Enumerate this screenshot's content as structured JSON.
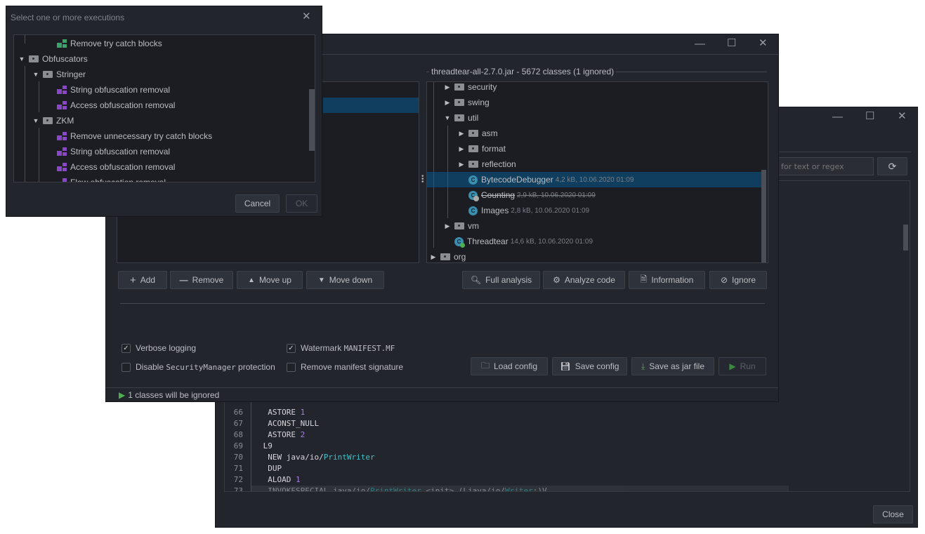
{
  "back_window": {
    "search_placeholder": "for text or regex",
    "close_label": "Close",
    "code_lines": [
      {
        "n": "66",
        "parts": [
          {
            "t": "  ASTORE "
          },
          {
            "t": "1",
            "c": "num"
          }
        ]
      },
      {
        "n": "67",
        "parts": [
          {
            "t": "  ACONST_NULL"
          }
        ]
      },
      {
        "n": "68",
        "parts": [
          {
            "t": "  ASTORE "
          },
          {
            "t": "2",
            "c": "num"
          }
        ]
      },
      {
        "n": "69",
        "parts": [
          {
            "t": " L9"
          }
        ]
      },
      {
        "n": "70",
        "parts": [
          {
            "t": "  NEW java/io/"
          },
          {
            "t": "PrintWriter",
            "c": "typ"
          }
        ]
      },
      {
        "n": "71",
        "parts": [
          {
            "t": "  DUP"
          }
        ]
      },
      {
        "n": "72",
        "parts": [
          {
            "t": "  ALOAD "
          },
          {
            "t": "1",
            "c": "num"
          }
        ]
      },
      {
        "n": "73",
        "parts": [
          {
            "t": "  INVOKESPECIAL java/io/"
          },
          {
            "t": "PrintWriter",
            "c": "typ"
          },
          {
            "t": ".<init> (Ljava/io/"
          },
          {
            "t": "Writer",
            "c": "typ"
          },
          {
            "t": ";)V"
          }
        ]
      }
    ]
  },
  "main_window": {
    "jar_title": "threadtear-all-2.7.0.jar - 5672 classes (1 ignored)",
    "tree": [
      {
        "label": "security",
        "type": "folder",
        "depth": 1,
        "arrow": "right"
      },
      {
        "label": "swing",
        "type": "folder",
        "depth": 1,
        "arrow": "right"
      },
      {
        "label": "util",
        "type": "folder",
        "depth": 1,
        "arrow": "down"
      },
      {
        "label": "asm",
        "type": "folder",
        "depth": 2,
        "arrow": "right"
      },
      {
        "label": "format",
        "type": "folder",
        "depth": 2,
        "arrow": "right"
      },
      {
        "label": "reflection",
        "type": "folder",
        "depth": 2,
        "arrow": "right"
      },
      {
        "label": "BytecodeDebugger",
        "meta": "4,2 kB, 10.06.2020 01:09",
        "type": "class",
        "depth": 2,
        "selected": true
      },
      {
        "label": "Counting",
        "meta": "2,9 kB, 10.06.2020 01:09",
        "type": "class",
        "depth": 2,
        "ignored": true
      },
      {
        "label": "Images",
        "meta": "2,8 kB, 10.06.2020 01:09",
        "type": "class",
        "depth": 2
      },
      {
        "label": "vm",
        "type": "folder",
        "depth": 1,
        "arrow": "right"
      },
      {
        "label": "Threadtear",
        "meta": "14,6 kB, 10.06.2020 01:09",
        "type": "class",
        "depth": 1,
        "main": true
      },
      {
        "label": "org",
        "type": "folder",
        "depth": 0,
        "arrow": "right"
      }
    ],
    "left_buttons": {
      "add": "Add",
      "remove": "Remove",
      "move_up": "Move up",
      "move_down": "Move down"
    },
    "right_buttons": {
      "full_analysis": "Full analysis",
      "analyze_code": "Analyze code",
      "information": "Information",
      "ignore": "Ignore"
    },
    "options": {
      "verbose": {
        "label": "Verbose logging",
        "checked": true
      },
      "watermark": {
        "label": "Watermark ",
        "code": "MANIFEST.MF",
        "checked": true
      },
      "disable_sm": {
        "label": "Disable ",
        "code": "SecurityManager",
        "label2": " protection",
        "checked": false
      },
      "remove_sig": {
        "label": "Remove manifest signature",
        "checked": false
      }
    },
    "action_buttons": {
      "load": "Load config",
      "save": "Save config",
      "save_jar": "Save as jar file",
      "run": "Run"
    },
    "status": "1 classes will be ignored"
  },
  "dialog": {
    "title": "Select one or more executions",
    "tree": [
      {
        "label": "Remove try catch blocks",
        "type": "exec",
        "color": "#3aa56b",
        "depth": 2
      },
      {
        "label": "Obfuscators",
        "type": "folder",
        "depth": 0,
        "arrow": "down"
      },
      {
        "label": "Stringer",
        "type": "folder",
        "depth": 1,
        "arrow": "down"
      },
      {
        "label": "String obfuscation removal",
        "type": "exec",
        "color": "#8a48c8",
        "depth": 2
      },
      {
        "label": "Access obfuscation removal",
        "type": "exec",
        "color": "#8a48c8",
        "depth": 2
      },
      {
        "label": "ZKM",
        "type": "folder",
        "depth": 1,
        "arrow": "down"
      },
      {
        "label": "Remove unnecessary try catch blocks",
        "type": "exec",
        "color": "#8a48c8",
        "depth": 2
      },
      {
        "label": "String obfuscation removal",
        "type": "exec",
        "color": "#8a48c8",
        "depth": 2
      },
      {
        "label": "Access obfuscation removal",
        "type": "exec",
        "color": "#8a48c8",
        "depth": 2
      },
      {
        "label": "Flow obfuscation removal",
        "type": "exec",
        "color": "#8a48c8",
        "depth": 2
      }
    ],
    "cancel": "Cancel",
    "ok": "OK"
  }
}
